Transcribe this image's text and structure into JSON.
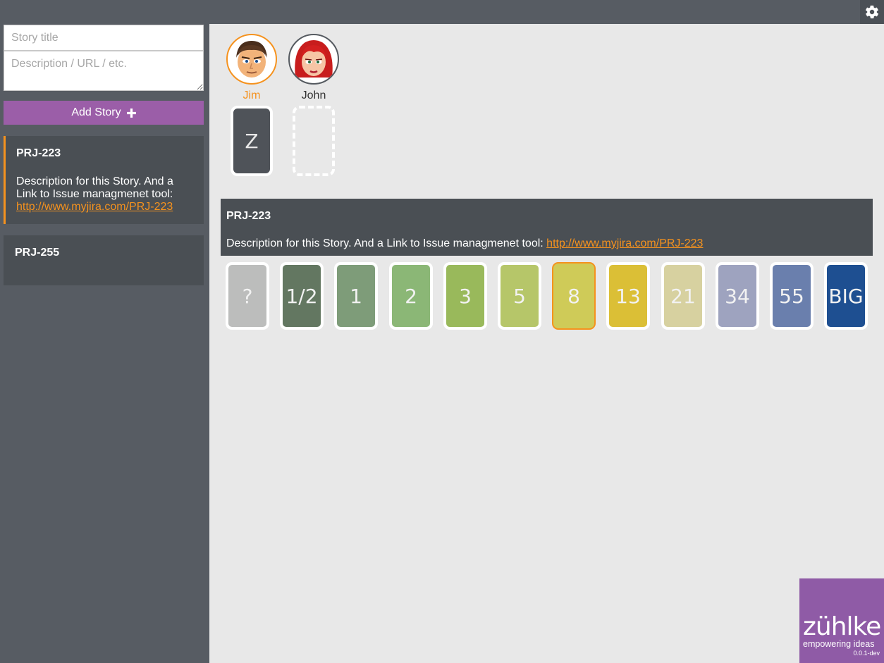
{
  "header": {
    "settings_icon": "gear-icon"
  },
  "new_story_form": {
    "title_placeholder": "Story title",
    "description_placeholder": "Description / URL / etc.",
    "add_button_label": "Add Story",
    "add_icon": "plus-icon"
  },
  "stories": [
    {
      "title": "PRJ-223",
      "description": "Description for this Story. And a Link to Issue managmenet tool:",
      "link": "http://www.myjira.com/PRJ-223",
      "selected": true
    },
    {
      "title": "PRJ-255",
      "description": "",
      "link": "",
      "selected": false
    }
  ],
  "users": [
    {
      "name": "Jim",
      "card": "Z",
      "highlighted": true,
      "color": "#f5921e",
      "card_state": "submitted"
    },
    {
      "name": "John",
      "card": "",
      "highlighted": false,
      "color": "#333333",
      "card_state": "pending"
    }
  ],
  "selected_story": {
    "title": "PRJ-223",
    "description": "Description for this Story. And a Link to Issue managmenet tool:",
    "link": "http://www.myjira.com/PRJ-223"
  },
  "estimation_cards": [
    {
      "label": "?",
      "color": "#bcbdbc"
    },
    {
      "label": "1/2",
      "color": "#637761"
    },
    {
      "label": "1",
      "color": "#7e9c79"
    },
    {
      "label": "2",
      "color": "#8bb776"
    },
    {
      "label": "3",
      "color": "#99b95b"
    },
    {
      "label": "5",
      "color": "#b6c669"
    },
    {
      "label": "8",
      "color": "#cfcb58",
      "selected": true
    },
    {
      "label": "13",
      "color": "#dbbf36"
    },
    {
      "label": "21",
      "color": "#d7d1a0"
    },
    {
      "label": "34",
      "color": "#9ea3bf"
    },
    {
      "label": "55",
      "color": "#6a7fad"
    },
    {
      "label": "BIG",
      "color": "#1e4f91"
    }
  ],
  "brand": {
    "logo_text": "zühlke",
    "tagline": "empowering ideas",
    "version": "0.0.1-dev",
    "color": "#8f5ba6"
  }
}
